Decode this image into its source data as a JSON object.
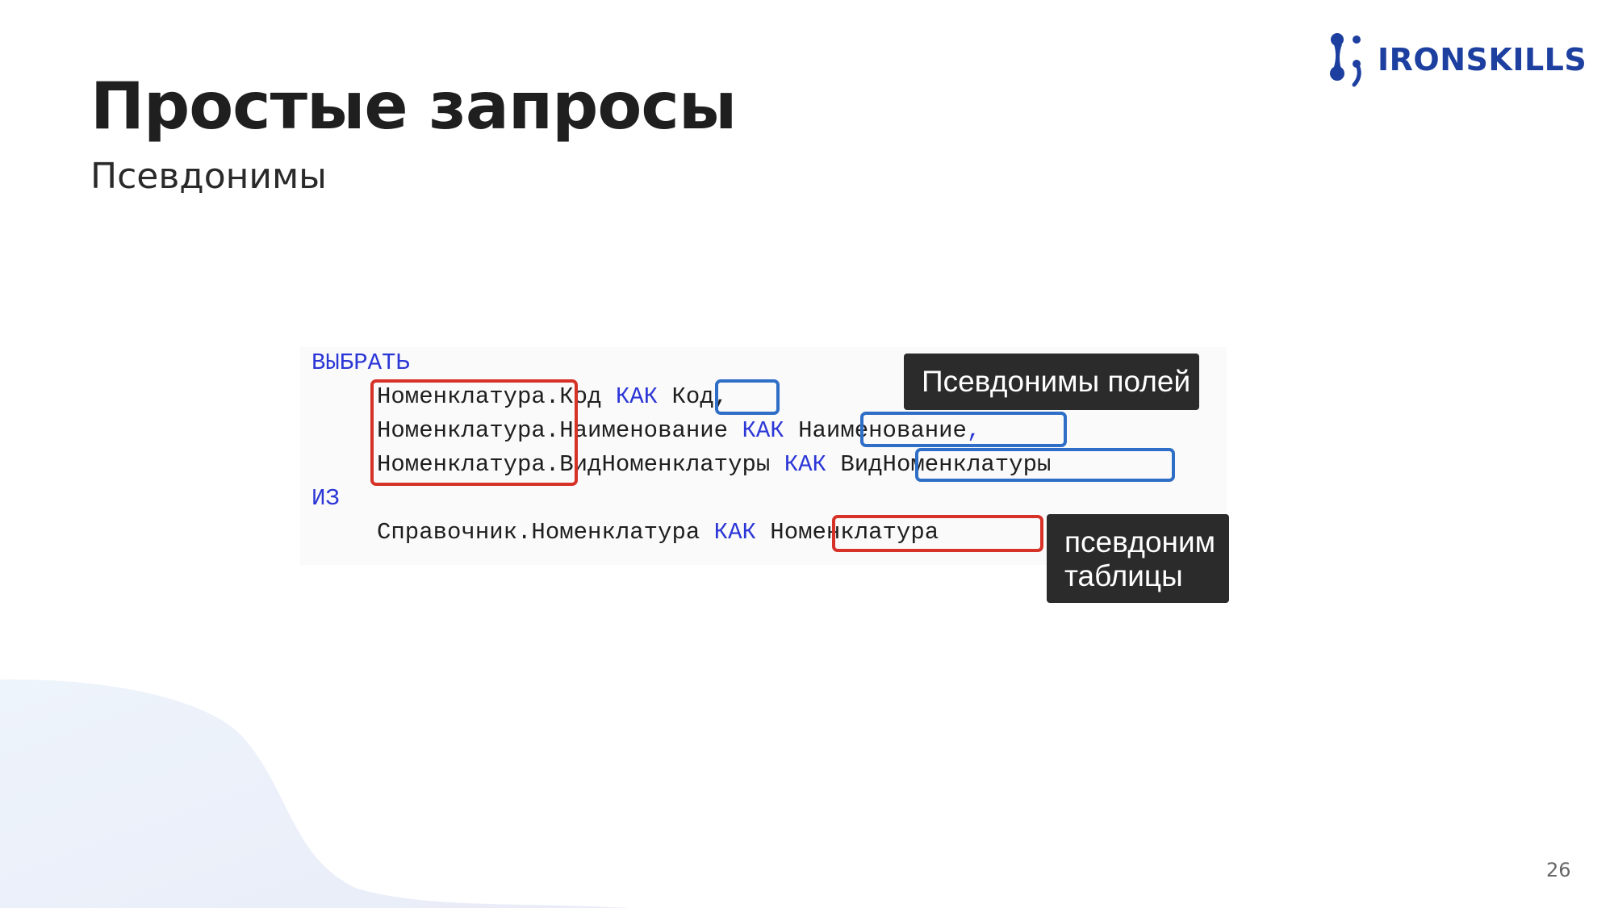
{
  "slide": {
    "title": "Простые запросы",
    "subtitle": "Псевдонимы",
    "page_number": "26"
  },
  "logo": {
    "text": "IRONSKILLS",
    "color": "#1c3fa0"
  },
  "code": {
    "line1_keyword": "ВЫБРАТЬ",
    "line2_table": "Номенклатура",
    "line2_field": ".Код",
    "line2_keyword": "КАК",
    "line2_alias": "Код",
    "line2_suffix": ",",
    "line3_table": "Номенклатура",
    "line3_field": ".Наименование",
    "line3_keyword": "КАК",
    "line3_alias": "Наименование",
    "line3_suffix": ",",
    "line4_table": "Номенклатура",
    "line4_field": ".ВидНоменклатуры",
    "line4_keyword": "КАК",
    "line4_alias": "ВидНоменклатуры",
    "line5_keyword": "ИЗ",
    "line6_source": "Справочник.Номенклатура",
    "line6_keyword": "КАК",
    "line6_alias": "Номенклатура"
  },
  "callouts": {
    "field_aliases": "Псевдонимы полей",
    "table_alias_line1": "псевдоним",
    "table_alias_line2": "таблицы"
  },
  "colors": {
    "keyword": "#2b36d6",
    "table_alias_box": "#d63228",
    "field_alias_box": "#2f6ec6",
    "callout_bg": "#2b2b2b"
  }
}
